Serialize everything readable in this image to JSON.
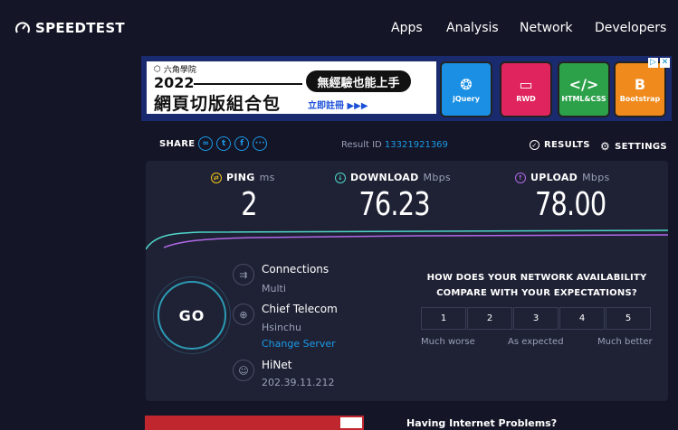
{
  "app": {
    "logo_text": "SPEEDTEST"
  },
  "nav": {
    "items": [
      "Apps",
      "Analysis",
      "Network",
      "Developers"
    ]
  },
  "ad": {
    "brand": "六角學院",
    "year": "2022",
    "title": "網頁切版組合包",
    "pill": "無經驗也能上手",
    "cta": "立即註冊 ▶▶▶",
    "tiles": [
      "jQuery",
      "RWD",
      "HTML&CSS",
      "Bootstrap"
    ],
    "tile_colors": [
      "#1a8fe3",
      "#e0245e",
      "#2ca14a",
      "#f08a1c"
    ]
  },
  "share": {
    "label": "SHARE"
  },
  "result": {
    "label": "Result ID",
    "id": "13321921369"
  },
  "links": {
    "results": "RESULTS",
    "settings": "SETTINGS"
  },
  "metrics": {
    "ping": {
      "label": "PING",
      "unit": "ms",
      "value": "2",
      "color": "#f5c518"
    },
    "download": {
      "label": "DOWNLOAD",
      "unit": "Mbps",
      "value": "76.23",
      "color": "#4fd6c8"
    },
    "upload": {
      "label": "UPLOAD",
      "unit": "Mbps",
      "value": "78.00",
      "color": "#b169e8"
    }
  },
  "go": {
    "label": "GO"
  },
  "connections": {
    "label": "Connections",
    "value": "Multi"
  },
  "server": {
    "name": "Chief Telecom",
    "location": "Hsinchu",
    "change": "Change Server"
  },
  "isp": {
    "name": "HiNet",
    "ip": "202.39.11.212"
  },
  "survey": {
    "question": "HOW DOES YOUR NETWORK AVAILABILITY COMPARE WITH YOUR EXPECTATIONS?",
    "options": [
      "1",
      "2",
      "3",
      "4",
      "5"
    ],
    "low": "Much worse",
    "mid": "As expected",
    "high": "Much better"
  },
  "footer": {
    "problems": "Having Internet Problems?"
  }
}
